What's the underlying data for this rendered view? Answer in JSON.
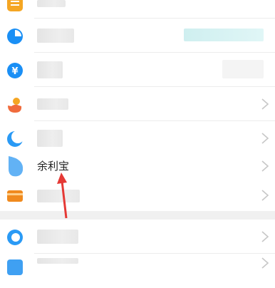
{
  "list": {
    "items": [
      {
        "id": "row-1",
        "icon": "list-icon",
        "icon_color": "#f5a623",
        "label": "",
        "label_blurred": true
      },
      {
        "id": "row-2",
        "icon": "pie-chart-icon",
        "icon_color": "#1a8ff5",
        "label": "",
        "label_blurred": true
      },
      {
        "id": "row-3",
        "icon": "yuan-icon",
        "icon_color": "#1a8ff5",
        "label": "",
        "label_blurred": true
      },
      {
        "id": "row-4",
        "icon": "hand-coin-icon",
        "icon_color": "#f06b3c",
        "label": "",
        "label_blurred": true
      },
      {
        "id": "row-5",
        "icon": "crescent-icon",
        "icon_color": "#2a9af5",
        "label": "",
        "label_blurred": true
      },
      {
        "id": "row-6",
        "icon": "drop-icon",
        "icon_color": "#62b2f5",
        "label": "余利宝",
        "label_blurred": false
      },
      {
        "id": "row-7",
        "icon": "card-icon",
        "icon_color": "#f08a1e",
        "label": "",
        "label_blurred": true
      },
      {
        "id": "row-8",
        "icon": "circle-icon",
        "icon_color": "#2a9af5",
        "label": "",
        "label_blurred": true
      },
      {
        "id": "row-9",
        "icon": "square-icon",
        "icon_color": "#3fa0f2",
        "label": "",
        "label_blurred": true
      }
    ]
  },
  "annotation": {
    "color": "#e53935"
  }
}
